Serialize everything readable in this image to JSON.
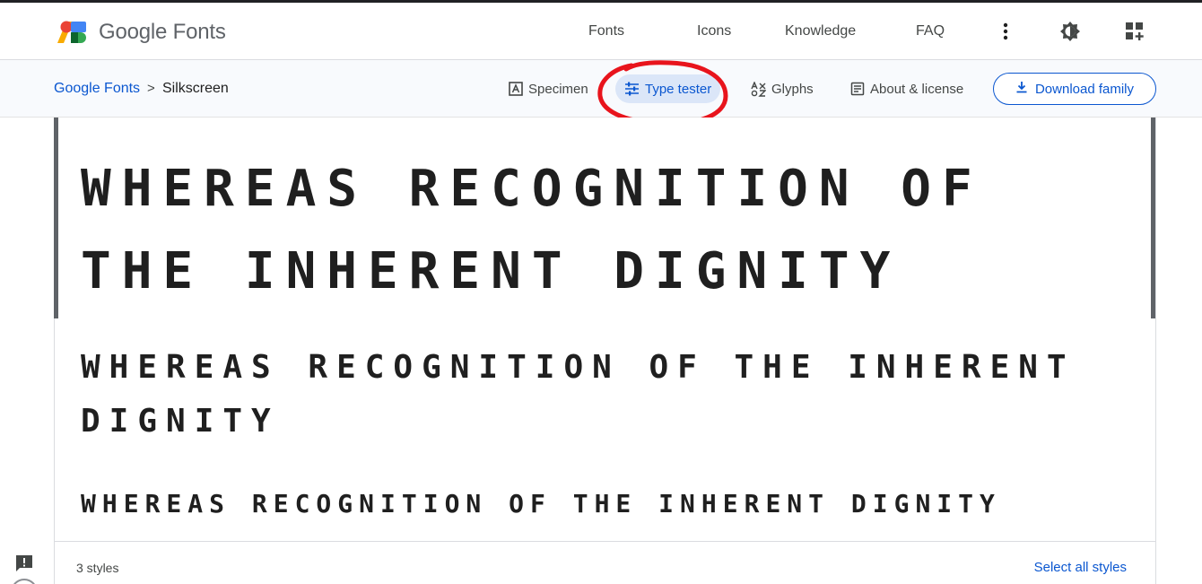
{
  "header": {
    "brand": "Google Fonts",
    "nav": [
      "Fonts",
      "Icons",
      "Knowledge",
      "FAQ"
    ],
    "icons": [
      "more-vert-icon",
      "theme-toggle-icon",
      "apps-grid-icon"
    ]
  },
  "subheader": {
    "breadcrumb_root": "Google Fonts",
    "breadcrumb_sep": ">",
    "breadcrumb_current": "Silkscreen",
    "tabs": [
      {
        "label": "Specimen",
        "icon": "specimen-icon"
      },
      {
        "label": "Type tester",
        "icon": "tune-icon"
      },
      {
        "label": "Glyphs",
        "icon": "glyphs-icon"
      },
      {
        "label": "About & license",
        "icon": "article-icon"
      }
    ],
    "active_tab": "Type tester",
    "download_label": "Download family"
  },
  "preview": {
    "sample_text": "Whereas recognition of the inherent dignity"
  },
  "footer": {
    "styles_count": "3 styles",
    "select_all": "Select all styles"
  },
  "colors": {
    "accent": "#0b57d0",
    "annotation": "#e8141c"
  }
}
